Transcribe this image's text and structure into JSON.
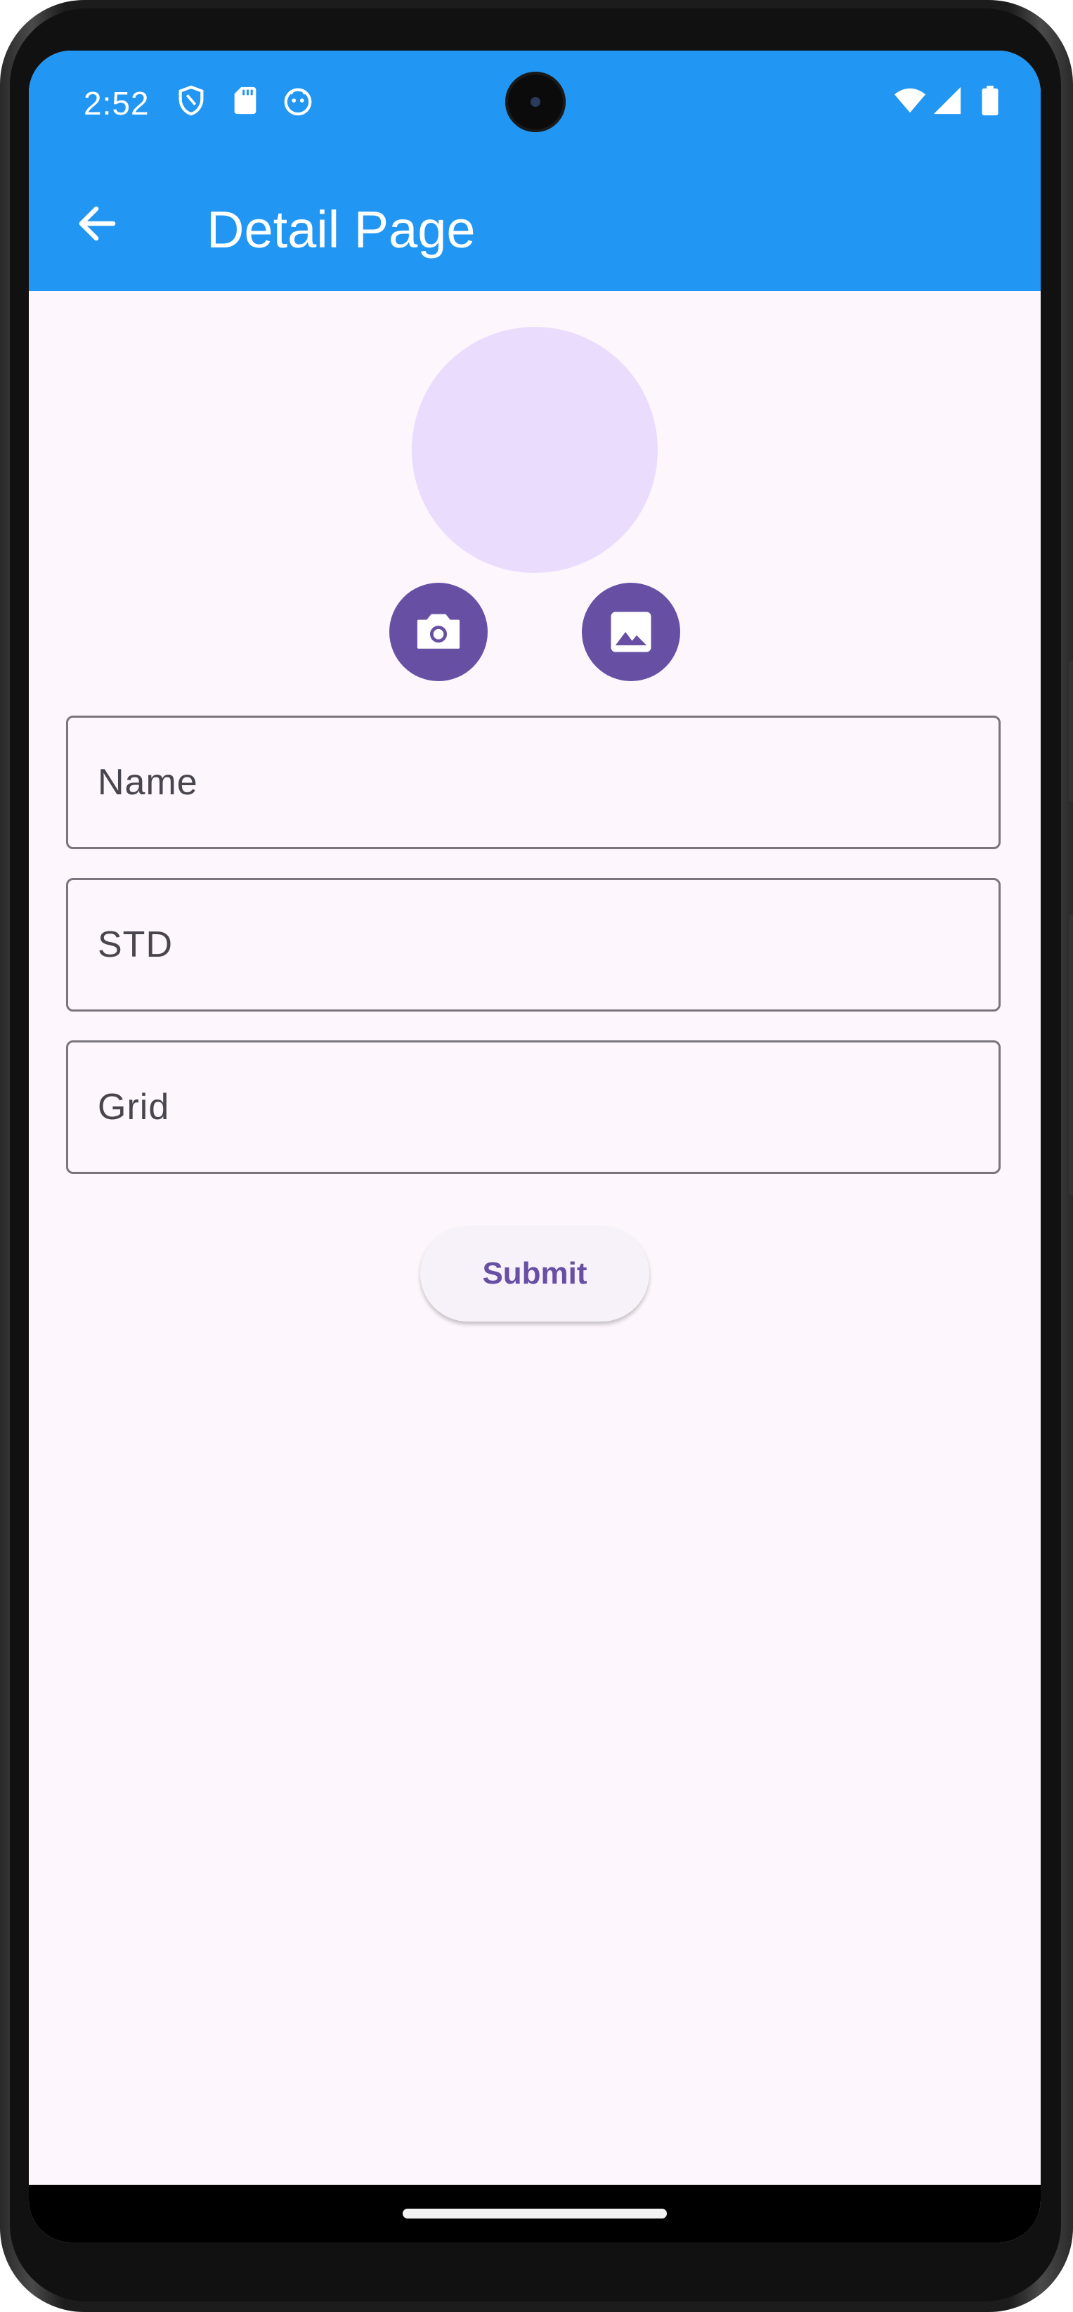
{
  "status_bar": {
    "time": "2:52",
    "left_icons": [
      "shield-icon",
      "sd-card-icon",
      "android-debug-icon"
    ],
    "right_icons": [
      "wifi-icon",
      "signal-icon",
      "battery-icon"
    ]
  },
  "app_bar": {
    "title": "Detail Page",
    "back_icon": "arrow-back-icon",
    "color": "#2196f3"
  },
  "photo": {
    "avatar_color": "#eadcfd",
    "buttons": [
      {
        "name": "camera-button",
        "icon": "camera-icon"
      },
      {
        "name": "gallery-button",
        "icon": "image-icon"
      }
    ],
    "button_color": "#6750a4"
  },
  "form": {
    "fields": [
      {
        "label": "Name",
        "value": ""
      },
      {
        "label": "STD",
        "value": ""
      },
      {
        "label": "Grid",
        "value": ""
      }
    ],
    "submit_label": "Submit"
  },
  "colors": {
    "background": "#fdf6fc",
    "primary": "#6750a4",
    "outline": "#79747e"
  }
}
